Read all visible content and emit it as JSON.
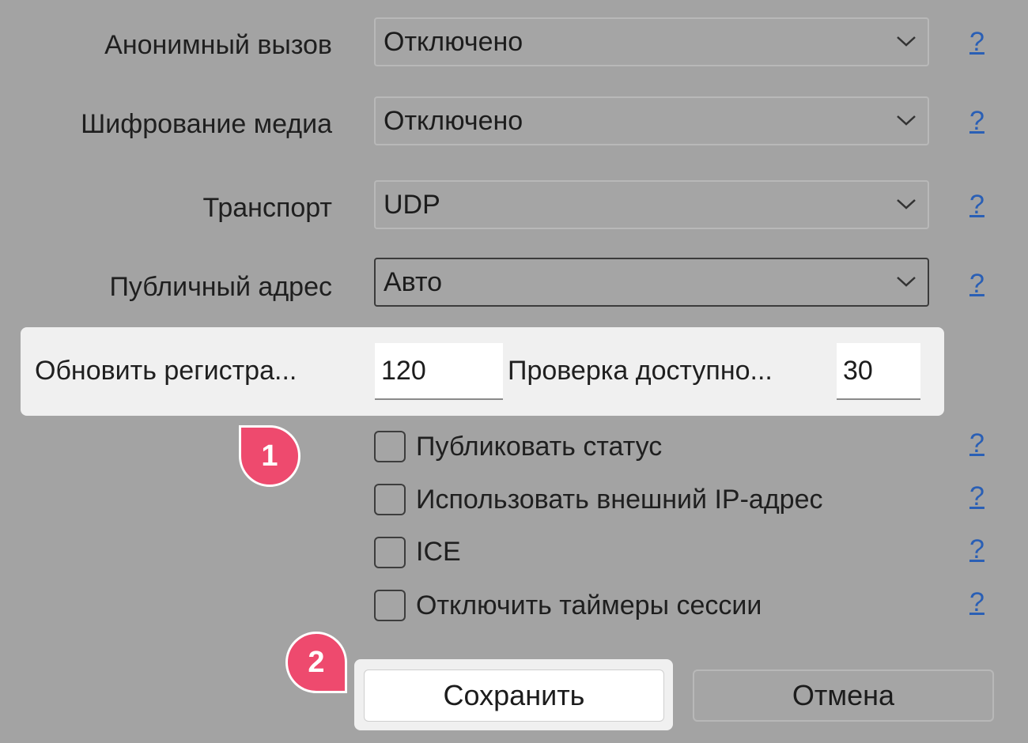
{
  "settings": {
    "anonymous_call": {
      "label": "Анонимный вызов",
      "value": "Отключено"
    },
    "media_encryption": {
      "label": "Шифрование медиа",
      "value": "Отключено"
    },
    "transport": {
      "label": "Транспорт",
      "value": "UDP"
    },
    "public_address": {
      "label": "Публичный адрес",
      "value": "Авто"
    }
  },
  "help_link": "?",
  "timers": {
    "refresh_label": "Обновить регистра...",
    "refresh_value": "120",
    "check_label": "Проверка доступно...",
    "check_value": "30"
  },
  "checkboxes": {
    "publish_status": {
      "label": "Публиковать статус",
      "checked": false
    },
    "use_external_ip": {
      "label": "Использовать внешний IP-адрес",
      "checked": false
    },
    "ice": {
      "label": "ICE",
      "checked": false
    },
    "disable_session_timers": {
      "label": "Отключить таймеры сессии",
      "checked": false
    }
  },
  "buttons": {
    "save": "Сохранить",
    "cancel": "Отмена"
  },
  "callouts": {
    "one": "1",
    "two": "2"
  },
  "colors": {
    "callout": "#ee4a6e",
    "highlight": "#f0f0f0",
    "link": "#2a5fb5",
    "background": "#a3a3a3"
  }
}
